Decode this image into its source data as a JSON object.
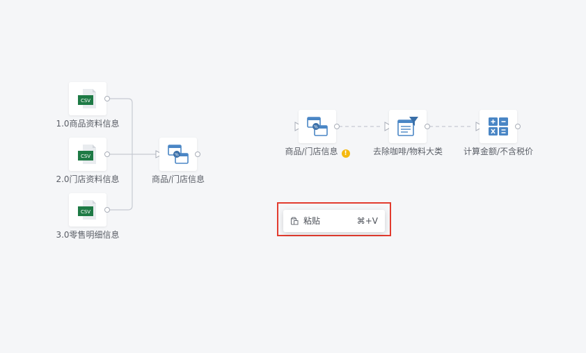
{
  "nodes": {
    "csv1": {
      "label": "1.0商品资料信息",
      "badge": "CSV",
      "icon": "csv-file-icon"
    },
    "csv2": {
      "label": "2.0门店资料信息",
      "badge": "CSV",
      "icon": "csv-file-icon"
    },
    "csv3": {
      "label": "3.0零售明细信息",
      "badge": "CSV",
      "icon": "csv-file-icon"
    },
    "join_left": {
      "label": "商品/门店信息",
      "icon": "join-icon"
    },
    "join_right": {
      "label": "商品/门店信息",
      "icon": "join-icon",
      "status": "warning-icon",
      "status_glyph": "!"
    },
    "filter": {
      "label": "去除咖啡/物料大类",
      "icon": "filter-table-icon"
    },
    "calc": {
      "label": "计算金额/不含税价",
      "icon": "calculator-icon"
    }
  },
  "context_menu": {
    "items": [
      {
        "label": "粘贴",
        "shortcut": "⌘+V",
        "icon": "paste-icon"
      }
    ]
  },
  "colors": {
    "background": "#f5f6f8",
    "csv_green": "#1e7a45",
    "icon_blue": "#4a86c5",
    "warning": "#f5b90f",
    "highlight": "#e23b2e"
  }
}
